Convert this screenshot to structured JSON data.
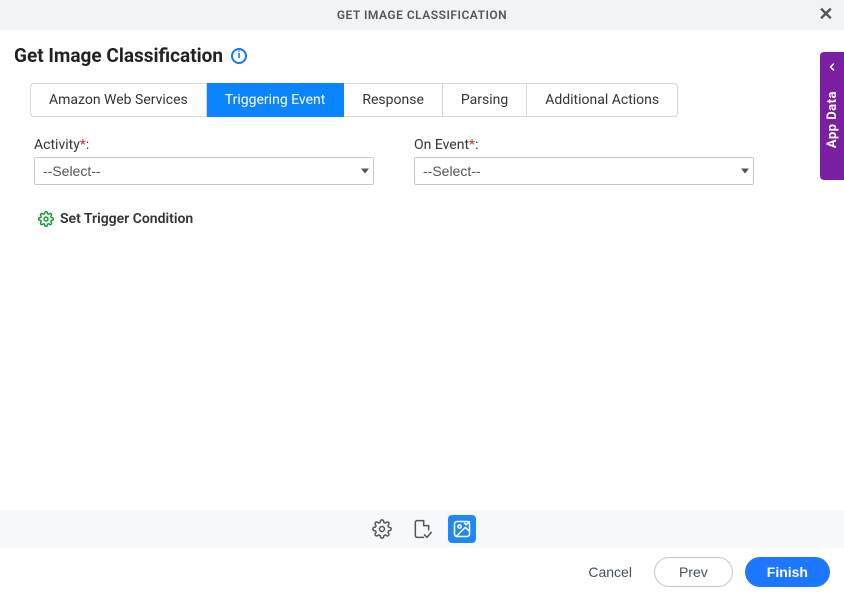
{
  "header": {
    "title": "GET IMAGE CLASSIFICATION"
  },
  "page": {
    "title": "Get Image Classification"
  },
  "tabs": [
    {
      "label": "Amazon Web Services",
      "active": false
    },
    {
      "label": "Triggering Event",
      "active": true
    },
    {
      "label": "Response",
      "active": false
    },
    {
      "label": "Parsing",
      "active": false
    },
    {
      "label": "Additional Actions",
      "active": false
    }
  ],
  "form": {
    "activity": {
      "label": "Activity",
      "value": "--Select--"
    },
    "onevent": {
      "label": "On Event",
      "value": "--Select--"
    }
  },
  "trigger": {
    "label": "Set Trigger Condition"
  },
  "sidepanel": {
    "label": "App Data"
  },
  "footer": {
    "cancel": "Cancel",
    "prev": "Prev",
    "finish": "Finish"
  }
}
